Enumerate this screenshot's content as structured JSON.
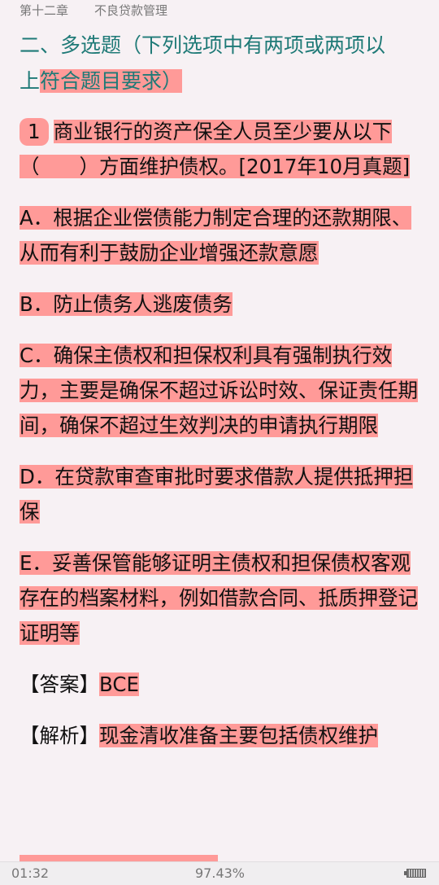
{
  "header": {
    "chapter": "第十二章",
    "title": "不良贷款管理"
  },
  "section": {
    "plain": "二、多选题（下列选项中有两项或两项以",
    "line2_plain": "上",
    "line2_hl": "符合题目要求）"
  },
  "question": {
    "number": "1",
    "text": "商业银行的资产保全人员至少要从以下（　　）方面维护债权。[2017年10月真题]"
  },
  "options": {
    "a": "A．根据企业偿债能力制定合理的还款期限、从而有利于鼓励企业增强还款意愿",
    "b": "B．防止债务人逃废债务",
    "c": "C．确保主债权和担保权利具有强制执行效力，主要是确保不超过诉讼时效、保证责任期间，确保不超过生效判决的申请执行期限",
    "d": "D．在贷款审查审批时要求借款人提供抵押担保",
    "e": "E．妥善保管能够证明主债权和担保债权客观存在的档案材料，例如借款合同、抵质押登记证明等"
  },
  "answer": {
    "label": "【答案】",
    "value": "BCE"
  },
  "analysis": {
    "label": "【解析】",
    "value": "现金清收准备主要包括债权维护"
  },
  "status": {
    "time": "01:32",
    "progress": "97.43%"
  }
}
